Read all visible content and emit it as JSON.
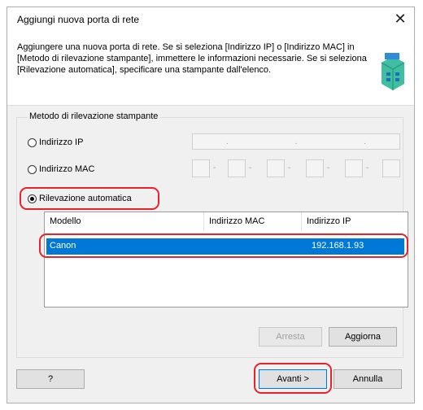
{
  "dialog": {
    "title": "Aggiungi nuova porta di rete",
    "close_glyph": "✕",
    "description": "Aggiungere una nuova porta di rete. Se si seleziona [Indirizzo IP] o [Indirizzo MAC] in [Metodo di rilevazione stampante], immettere le informazioni necessarie. Se si seleziona [Rilevazione automatica], specificare una stampante dall'elenco.",
    "icon": "printer-icon"
  },
  "detection": {
    "group_label": "Metodo di rilevazione stampante",
    "options": [
      {
        "label": "Indirizzo IP",
        "checked": false
      },
      {
        "label": "Indirizzo MAC",
        "checked": false
      },
      {
        "label": "Rilevazione automatica",
        "checked": true
      }
    ],
    "ip_separator": ".",
    "mac_separator": "-"
  },
  "printer_list": {
    "columns": [
      "Modello",
      "Indirizzo MAC",
      "Indirizzo IP"
    ],
    "rows": [
      {
        "model": "Canon",
        "mac": "",
        "ip": "192.168.1.93",
        "selected": true
      }
    ]
  },
  "buttons": {
    "stop": "Arresta",
    "refresh": "Aggiorna",
    "help": "?",
    "next": "Avanti >",
    "cancel": "Annulla"
  },
  "colors": {
    "selection": "#0078d7",
    "highlight": "#e8232a"
  }
}
